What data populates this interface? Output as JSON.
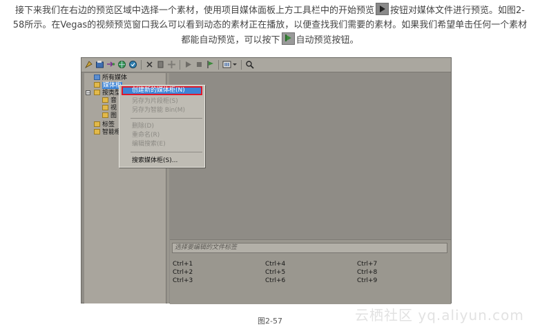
{
  "paragraph": {
    "part1": "接下来我们在右边的预览区域中选择一个素材，使用项目媒体面板上方工具栏中的开始预览",
    "part2": "按钮对媒体文件进行预览。如图2-58所示。在Vegas的视频预览窗口我么可以看到动态的素材正在播放，以便查找我们需要的素材。如果我们希望单击任何一个素材都能自动预览，可以按下",
    "part3": "自动预览按钮。",
    "icon_play": "play-icon",
    "icon_auto": "auto-preview-icon"
  },
  "tree": {
    "all_media": "所有媒体",
    "media_bin": "媒体柜",
    "by_type": "按类型",
    "audio": "音",
    "video": "视",
    "image": "图",
    "tags": "标签",
    "smart": "智能柜"
  },
  "context_menu": {
    "new_bin": "创建新的媒体柜(N)",
    "save_as_bin": "另存为片段柜(S)",
    "save_as_smart": "另存为智能 Bin(M)",
    "delete": "删除(D)",
    "rename": "重命名(R)",
    "edit_search": "编辑搜索(E)",
    "search_bins": "搜索媒体柜(S)..."
  },
  "tag_panel": {
    "placeholder": "选择要编辑的文件标签",
    "shortcuts": [
      "Ctrl+1",
      "Ctrl+2",
      "Ctrl+3",
      "Ctrl+4",
      "Ctrl+5",
      "Ctrl+6",
      "Ctrl+7",
      "Ctrl+8",
      "Ctrl+9"
    ]
  },
  "caption": "图2-57",
  "watermark": "云栖社区 yq.aliyun.com",
  "colors": {
    "highlight": "#3d84d6",
    "highlight_border": "#e0182a",
    "panel": "#8f8c86"
  }
}
